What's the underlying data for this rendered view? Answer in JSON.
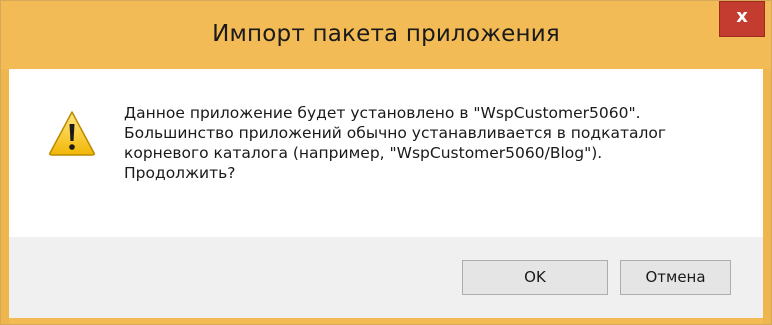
{
  "dialog": {
    "title": "Импорт пакета приложения",
    "close_glyph": "x",
    "icon": "warning-icon",
    "message_lines": [
      "Данное приложение будет установлено в \"WspCustomer5060\".",
      "Большинство приложений обычно устанавливается в подкаталог",
      "корневого каталога (например, \"WspCustomer5060/Blog\").",
      "Продолжить?"
    ],
    "ok_label": "OK",
    "cancel_label": "Отмена"
  },
  "colors": {
    "titlebar": "#f2bb55",
    "close_button": "#c43c2f",
    "footer": "#f0f0f0"
  }
}
